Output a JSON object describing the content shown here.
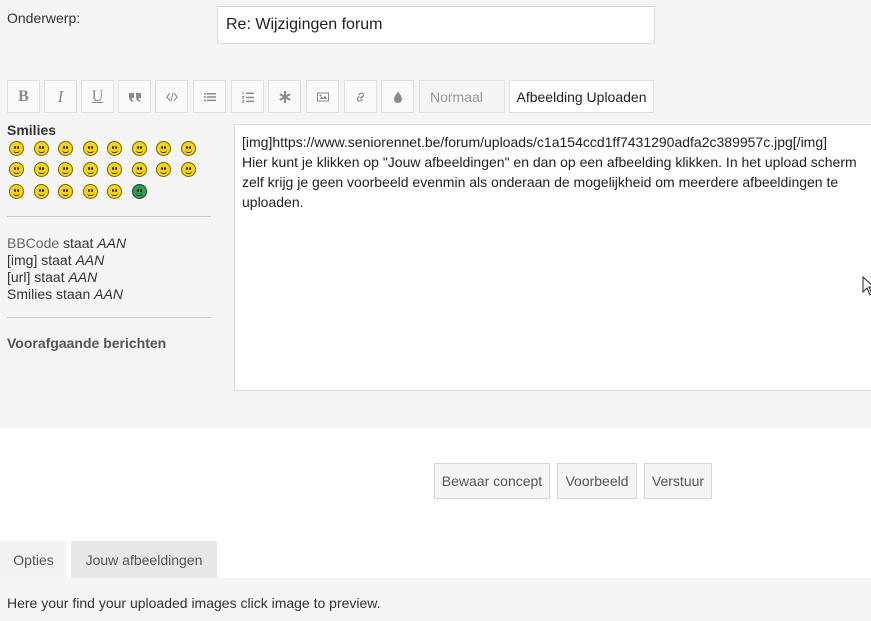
{
  "subject": {
    "label": "Onderwerp:",
    "value": "Re: Wijzigingen forum"
  },
  "toolbar": {
    "buttons": [
      {
        "name": "bold-button",
        "icon": "bold-icon"
      },
      {
        "name": "italic-button",
        "icon": "italic-icon"
      },
      {
        "name": "underline-button",
        "icon": "underline-icon"
      },
      {
        "name": "quote-button",
        "icon": "quote-icon"
      },
      {
        "name": "code-button",
        "icon": "code-icon"
      },
      {
        "name": "bullet-list-button",
        "icon": "list-icon"
      },
      {
        "name": "numbered-list-button",
        "icon": "numbered-list-icon"
      },
      {
        "name": "list-item-button",
        "icon": "asterisk-icon"
      },
      {
        "name": "image-button",
        "icon": "image-icon"
      },
      {
        "name": "link-button",
        "icon": "link-icon"
      },
      {
        "name": "color-button",
        "icon": "droplet-icon"
      }
    ],
    "font_size_value": "Normaal",
    "upload_label": "Afbeelding Uploaden"
  },
  "sidebar": {
    "smilies_title": "Smilies",
    "bbcode": {
      "line1_link": "BBCode",
      "line1_rest": " staat ",
      "line1_state": "AAN",
      "line2_text": "[img] staat ",
      "line2_state": "AAN",
      "line3_text": "[url] staat ",
      "line3_state": "AAN",
      "line4_text": "Smilies staan ",
      "line4_state": "AAN"
    },
    "previous_posts": "Voorafgaande berichten"
  },
  "editor": {
    "text": "[img]https://www.seniorennet.be/forum/uploads/c1a154ccd1ff7431290adfa2c389957c.jpg[/img]\nHier kunt je klikken op \"Jouw afbeeldingen\" en dan op een afbeelding klikken. In het upload scherm zelf krijg je geen voorbeeld evenmin als onderaan de mogelijkheid om meerdere afbeeldingen te uploaden."
  },
  "actions": {
    "save_draft": "Bewaar concept",
    "preview": "Voorbeeld",
    "submit": "Verstuur"
  },
  "tabs": [
    {
      "label": "Opties"
    },
    {
      "label": "Jouw afbeeldingen"
    }
  ],
  "footer": {
    "text": "Here your find your uploaded images click image to preview."
  },
  "colors": {
    "panel_bg": "#f5f5f5",
    "border": "#dddddd",
    "smiley_yellow": "#f6d513"
  }
}
